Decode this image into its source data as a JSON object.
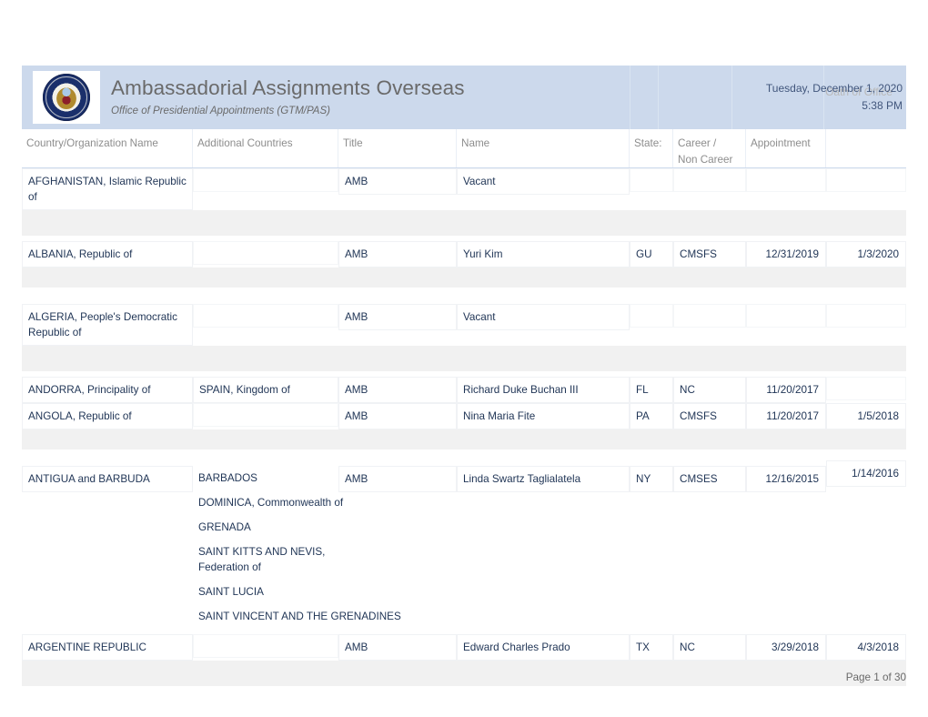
{
  "header": {
    "title": "Ambassadorial Assignments Overseas",
    "subtitle": "Office of Presidential Appointments (GTM/PAS)",
    "seal_icon": "us-department-of-state-seal-icon",
    "date": "Tuesday, December 1, 2020",
    "time": "5:38 PM",
    "oath_column_label": "Oath of Office",
    "band_color": "#ccd9ec"
  },
  "columns": {
    "country": "Country/Organization Name",
    "additional": "Additional Countries",
    "title": "Title",
    "name": "Name",
    "state": "State:",
    "career_line1": "Career /",
    "career_line2": "Non Career",
    "appointment": "Appointment",
    "oath": "Oath of Office"
  },
  "rows": [
    {
      "country": "AFGHANISTAN, Islamic Republic of",
      "additional": [],
      "title": "AMB",
      "name": "Vacant",
      "state": "",
      "career": "",
      "appointment": "",
      "oath": ""
    },
    {
      "country": "ALBANIA, Republic of",
      "additional": [],
      "title": "AMB",
      "name": "Yuri  Kim",
      "state": "GU",
      "career": "CMSFS",
      "appointment": "12/31/2019",
      "oath": "1/3/2020"
    },
    {
      "country": "ALGERIA, People's Democratic Republic of",
      "additional": [],
      "title": "AMB",
      "name": "Vacant",
      "state": "",
      "career": "",
      "appointment": "",
      "oath": ""
    },
    {
      "country": "ANDORRA, Principality of",
      "additional": [
        "SPAIN, Kingdom of"
      ],
      "title": "AMB",
      "name": "Richard Duke Buchan III",
      "state": "FL",
      "career": "NC",
      "appointment": "11/20/2017",
      "oath": ""
    },
    {
      "country": "ANGOLA, Republic of",
      "additional": [],
      "title": "AMB",
      "name": "Nina Maria Fite",
      "state": "PA",
      "career": "CMSFS",
      "appointment": "11/20/2017",
      "oath": "1/5/2018"
    },
    {
      "country": "ANTIGUA and BARBUDA",
      "additional": [
        "BARBADOS",
        "DOMINICA, Commonwealth of",
        "GRENADA",
        "SAINT KITTS AND NEVIS, Federation of",
        "SAINT LUCIA",
        "SAINT VINCENT AND THE GRENADINES"
      ],
      "title": "AMB",
      "name": "Linda Swartz Taglialatela",
      "state": "NY",
      "career": "CMSES",
      "appointment": "12/16/2015",
      "oath": "1/14/2016"
    },
    {
      "country": "ARGENTINE REPUBLIC",
      "additional": [],
      "title": "AMB",
      "name": "Edward Charles Prado",
      "state": "TX",
      "career": "NC",
      "appointment": "3/29/2018",
      "oath": "4/3/2018"
    }
  ],
  "footer": {
    "page_label": "Page 1 of 30"
  }
}
